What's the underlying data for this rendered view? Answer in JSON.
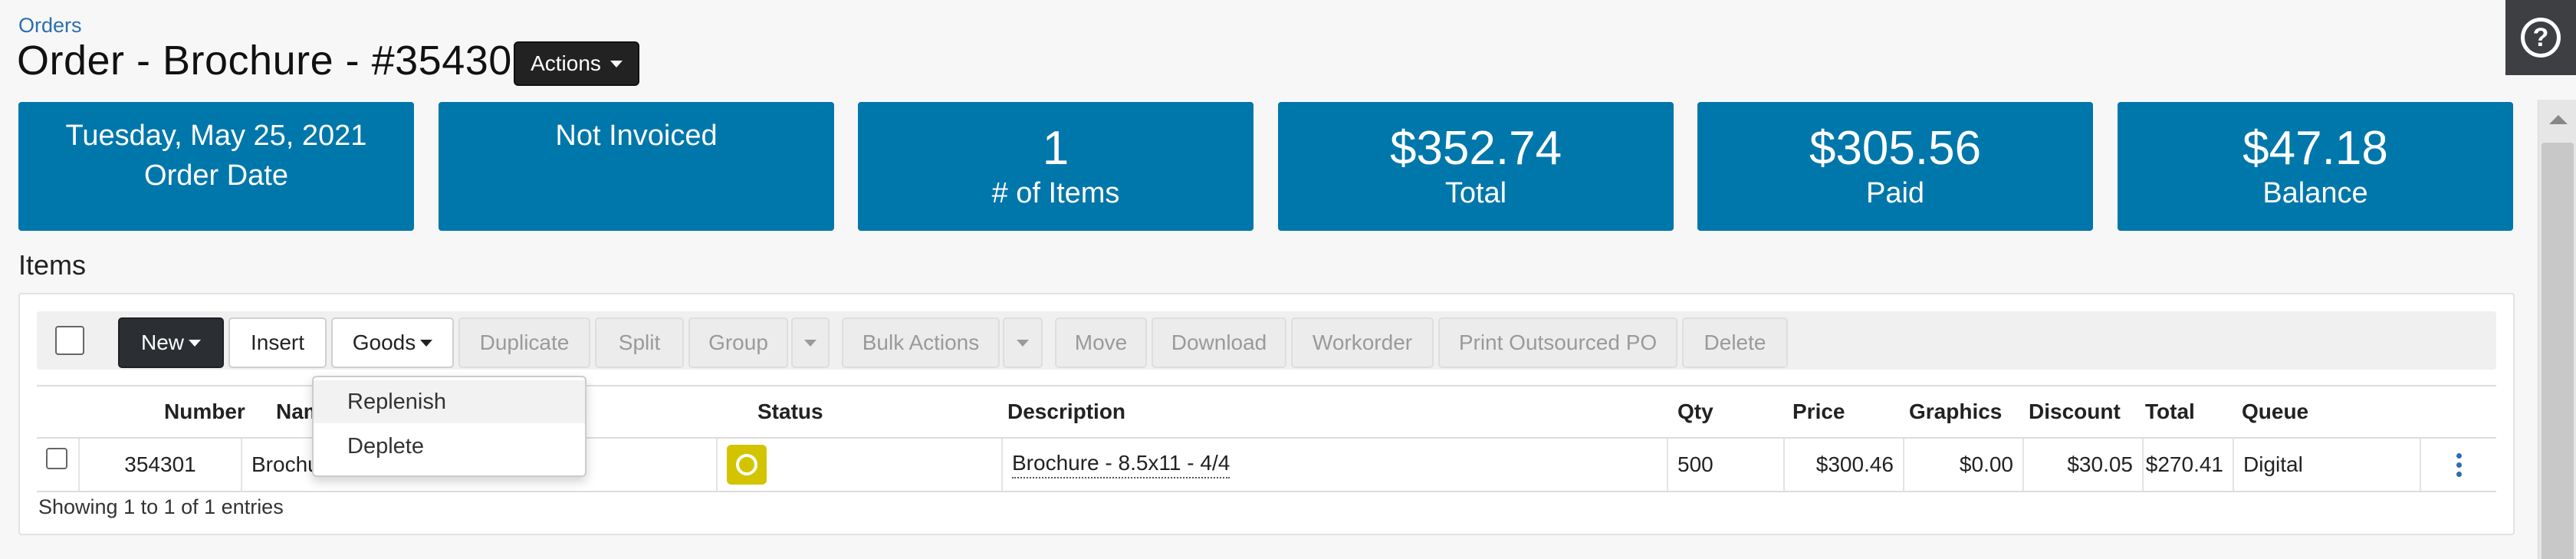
{
  "breadcrumb": "Orders",
  "title": "Order - Brochure - #35430",
  "actions_label": "Actions",
  "help_glyph": "?",
  "cards": [
    {
      "line1": "Tuesday, May 25, 2021",
      "line2": "Order Date"
    },
    {
      "line1": "Not Invoiced",
      "line2": ""
    },
    {
      "value": "1",
      "label": "# of Items"
    },
    {
      "value": "$352.74",
      "label": "Total"
    },
    {
      "value": "$305.56",
      "label": "Paid"
    },
    {
      "value": "$47.18",
      "label": "Balance"
    }
  ],
  "items_title": "Items",
  "toolbar": {
    "new": "New",
    "insert": "Insert",
    "goods": "Goods",
    "duplicate": "Duplicate",
    "split": "Split",
    "group": "Group",
    "bulk_actions": "Bulk Actions",
    "move": "Move",
    "download": "Download",
    "workorder": "Workorder",
    "print_outsourced_po": "Print Outsourced PO",
    "delete": "Delete"
  },
  "goods_menu": {
    "items": [
      "Replenish",
      "Deplete"
    ]
  },
  "table": {
    "columns": {
      "number": "Number",
      "name": "Name",
      "status": "Status",
      "description": "Description",
      "qty": "Qty",
      "price": "Price",
      "graphics": "Graphics",
      "discount": "Discount",
      "total": "Total",
      "queue": "Queue"
    },
    "rows": [
      {
        "number": "354301",
        "name": "Brochure",
        "status": "in-progress",
        "description": "Brochure - 8.5x11 - 4/4",
        "qty": "500",
        "price": "$300.46",
        "graphics": "$0.00",
        "discount": "$30.05",
        "total": "$270.41",
        "queue": "Digital"
      }
    ],
    "footer": "Showing 1 to 1 of 1 entries"
  },
  "colors": {
    "card_bg": "#0077aa",
    "status_yellow": "#d4c400",
    "link_blue": "#2a6fb0"
  }
}
